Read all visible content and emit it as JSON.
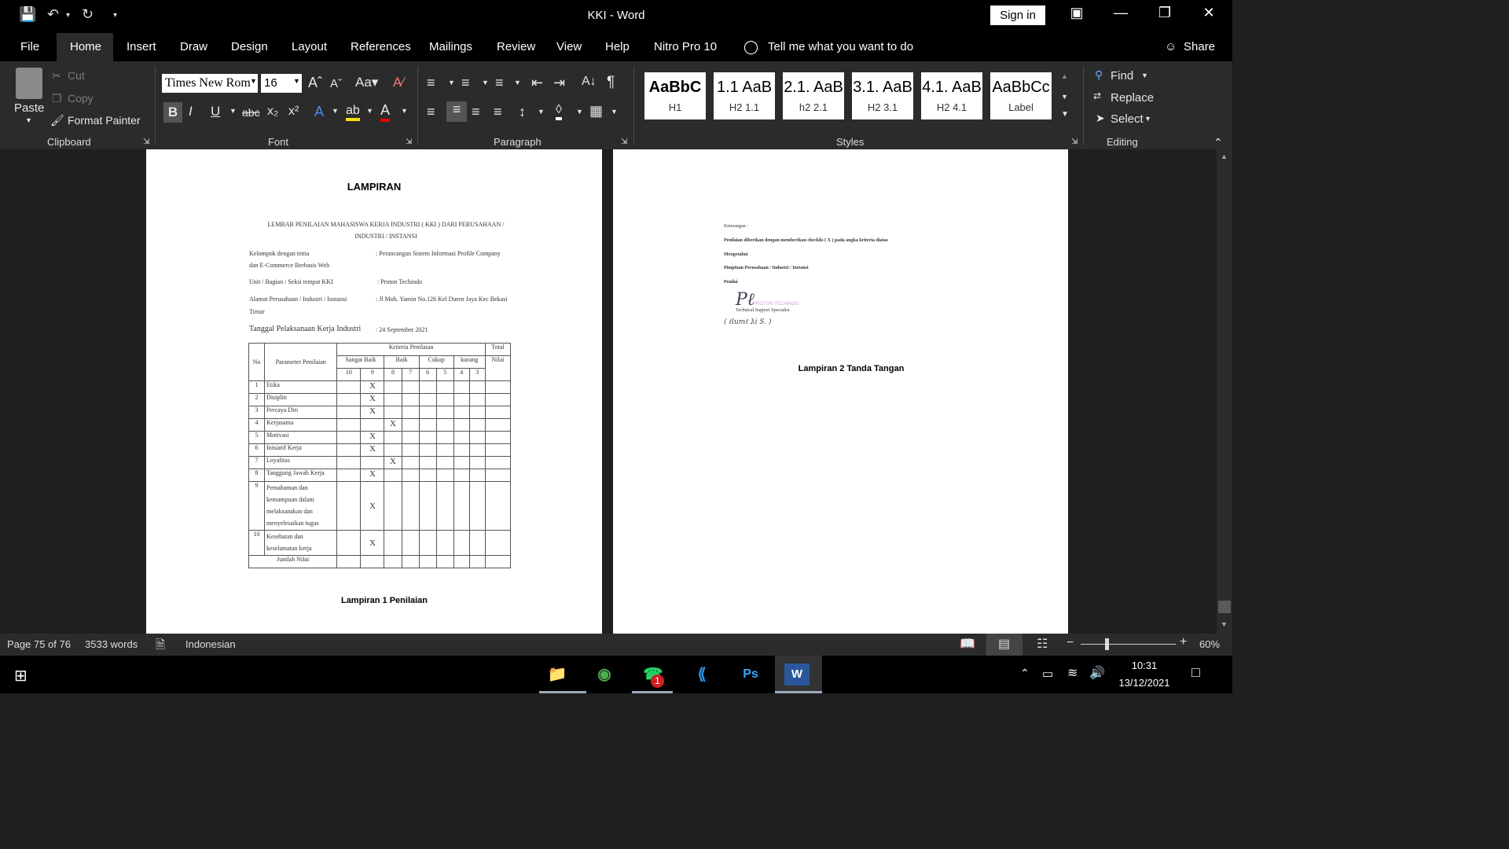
{
  "titlebar": {
    "title": "KKI  -  Word",
    "sign_in": "Sign in"
  },
  "menu": {
    "items": [
      "File",
      "Home",
      "Insert",
      "Draw",
      "Design",
      "Layout",
      "References",
      "Mailings",
      "Review",
      "View",
      "Help",
      "Nitro Pro 10"
    ],
    "tell_me": "Tell me what you want to do",
    "share": "Share"
  },
  "ribbon": {
    "clipboard": {
      "paste": "Paste",
      "cut": "Cut",
      "copy": "Copy",
      "format_painter": "Format Painter",
      "label": "Clipboard"
    },
    "font": {
      "family": "Times New Rom",
      "size": "16",
      "label": "Font"
    },
    "paragraph": {
      "label": "Paragraph"
    },
    "styles": {
      "label": "Styles",
      "cards": [
        {
          "sample": "AaBbC",
          "name": "H1"
        },
        {
          "sample": "1.1  AaB",
          "name": "H2 1.1"
        },
        {
          "sample": "2.1.  AaB",
          "name": "h2 2.1"
        },
        {
          "sample": "3.1.  AaB",
          "name": "H2 3.1"
        },
        {
          "sample": "4.1.  AaB",
          "name": "H2 4.1"
        },
        {
          "sample": "AaBbCc",
          "name": "Label"
        }
      ]
    },
    "editing": {
      "find": "Find",
      "replace": "Replace",
      "select": "Select",
      "label": "Editing"
    }
  },
  "document": {
    "page1": {
      "heading": "LAMPIRAN",
      "scan_title_1": "LEMBAR PENILAIAN MAHASISWA KERJA INDUSTRI ( KKI ) DARI PERUSAHAAN /",
      "scan_title_2": "INDUSTRI / INSTANSI",
      "fields": [
        {
          "label": "Kelompok dengan tema",
          "value": ": Perancangan  Sistem  Informasi  Profile  Company"
        },
        {
          "label": "dan E-Commerce Berbasis Web",
          "value": ""
        },
        {
          "label": "Unit / Bagian / Seksi tempat KKI",
          "value": ": Proton Techindo"
        },
        {
          "label": "Alamat Perusahaan / Industri / Instansi",
          "value": ": Jl Moh. Yamin No.126 Kel Duren Jaya Kec Bekasi"
        },
        {
          "label": "Timur",
          "value": ""
        }
      ],
      "date_label": "Tanggal Pelaksanaan Kerja Industri",
      "date_value": ": 24 September 2021",
      "table": {
        "h_no": "No",
        "h_param": "Parameter Penilaian",
        "h_kriteria": "Kriteria Penilaian",
        "h_total": "Total",
        "h_nilai": "Nilai",
        "groups": [
          "Sangat Baik",
          "Baik",
          "Cukup",
          "kurang"
        ],
        "scores": [
          "10",
          "9",
          "8",
          "7",
          "6",
          "5",
          "4",
          "3"
        ],
        "rows": [
          {
            "no": "1",
            "param": "Etika",
            "mark": "X"
          },
          {
            "no": "2",
            "param": "Disiplin",
            "mark": "X"
          },
          {
            "no": "3",
            "param": "Percaya Diri",
            "mark": "X"
          },
          {
            "no": "4",
            "param": "Kerjasama",
            "mark": "X"
          },
          {
            "no": "5",
            "param": "Motivasi",
            "mark": "X"
          },
          {
            "no": "6",
            "param": "Inisiatif Kerja",
            "mark": "X"
          },
          {
            "no": "7",
            "param": "Loyalitas",
            "mark": "X"
          },
          {
            "no": "8",
            "param": "Tanggung Jawab Kerja",
            "mark": "X"
          },
          {
            "no": "9",
            "param": "Pemahaman dan kemampuan dalam melaksanakan dan menyelesaikan tugas",
            "mark": "X"
          },
          {
            "no": "10",
            "param": "Kesehatan dan keselamatan kerja",
            "mark": "X"
          }
        ],
        "footer": "Jumlah Nilai"
      },
      "caption": "Lampiran 1 Penilaian"
    },
    "page2": {
      "keterangan": "Keterangan :",
      "note": "Penilaian diberikan dengan memberikan checklis ( X ) pada angka kriteria diatas",
      "mengetahui": "Mengetahui",
      "pimpinan": "Pimpinan Perusahaan / Industri / Instansi",
      "penilai": "Penilai",
      "stamp_company": "PROTON TECHINDO",
      "stamp_title": "Technical Support Specialist",
      "caption": "Lampiran 2 Tanda Tangan"
    }
  },
  "status": {
    "page": "Page 75 of 76",
    "words": "3533 words",
    "language": "Indonesian",
    "zoom": "60%"
  },
  "taskbar": {
    "time": "10:31",
    "date": "13/12/2021",
    "whatsapp_badge": "1"
  }
}
